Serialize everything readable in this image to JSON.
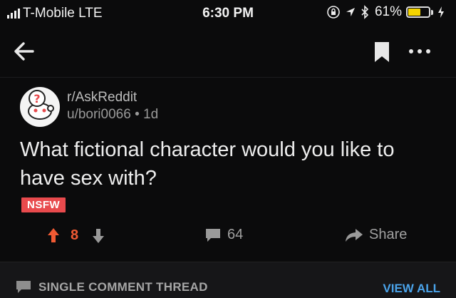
{
  "status_bar": {
    "carrier": "T-Mobile  LTE",
    "time": "6:30 PM",
    "battery_pct": "61%",
    "battery_level": 0.61,
    "battery_color": "#f4d400",
    "icons": [
      "signal-bars-icon",
      "orientation-lock-icon",
      "location-arrow-icon",
      "bluetooth-icon",
      "battery-icon",
      "charging-bolt-icon"
    ]
  },
  "nav": {
    "icons": [
      "back-arrow-icon",
      "bookmark-icon",
      "more-dots-icon"
    ]
  },
  "post": {
    "subreddit": "r/AskReddit",
    "author": "u/bori0066",
    "separator": "•",
    "age": "1d",
    "title": "What fictional character would you like to have sex with?",
    "badge": "NSFW",
    "badge_color": "#e84a4d"
  },
  "actions": {
    "score": "8",
    "score_color": "#f05a33",
    "comments": "64",
    "share": "Share"
  },
  "footer": {
    "label": "SINGLE COMMENT THREAD",
    "view_all": "VIEW ALL",
    "view_all_color": "#4aa3ea"
  }
}
